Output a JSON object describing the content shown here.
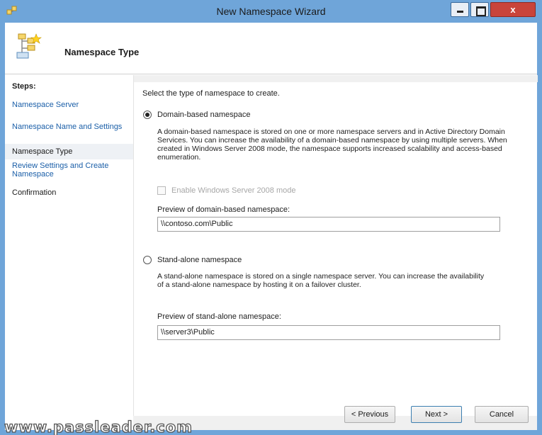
{
  "window": {
    "title": "New Namespace Wizard",
    "close_glyph": "x",
    "accent": "#6fa5d9"
  },
  "header": {
    "title": "Namespace Type",
    "icon": "namespace-icon"
  },
  "steps": {
    "label": "Steps:",
    "items": [
      {
        "label": "Namespace Server",
        "state": "link"
      },
      {
        "label": "Namespace Name and Settings",
        "state": "link"
      },
      {
        "label": "Namespace Type",
        "state": "current"
      },
      {
        "label": "Review Settings and Create Namespace",
        "state": "link"
      },
      {
        "label": "Confirmation",
        "state": "disabled"
      }
    ]
  },
  "main": {
    "intro": "Select the type of namespace to create.",
    "domain": {
      "label": "Domain-based namespace",
      "selected": true,
      "description": "A domain-based namespace is stored on one or more namespace servers and in Active Directory Domain Services. You can increase the availability of a domain-based namespace by using multiple servers. When created in Windows Server 2008 mode, the namespace supports increased scalability and access-based enumeration.",
      "checkbox_label": "Enable Windows Server 2008 mode",
      "preview_label": "Preview of domain-based namespace:",
      "preview_value": "\\\\contoso.com\\Public"
    },
    "standalone": {
      "label": "Stand-alone namespace",
      "selected": false,
      "description": "A stand-alone namespace is stored on a single namespace server. You can increase the availability of a stand-alone namespace by hosting it on a failover cluster.",
      "preview_label": "Preview of stand-alone namespace:",
      "preview_value": "\\\\server3\\Public"
    }
  },
  "buttons": {
    "previous": "< Previous",
    "next": "Next >",
    "cancel": "Cancel"
  },
  "watermark": "www.passleader.com"
}
